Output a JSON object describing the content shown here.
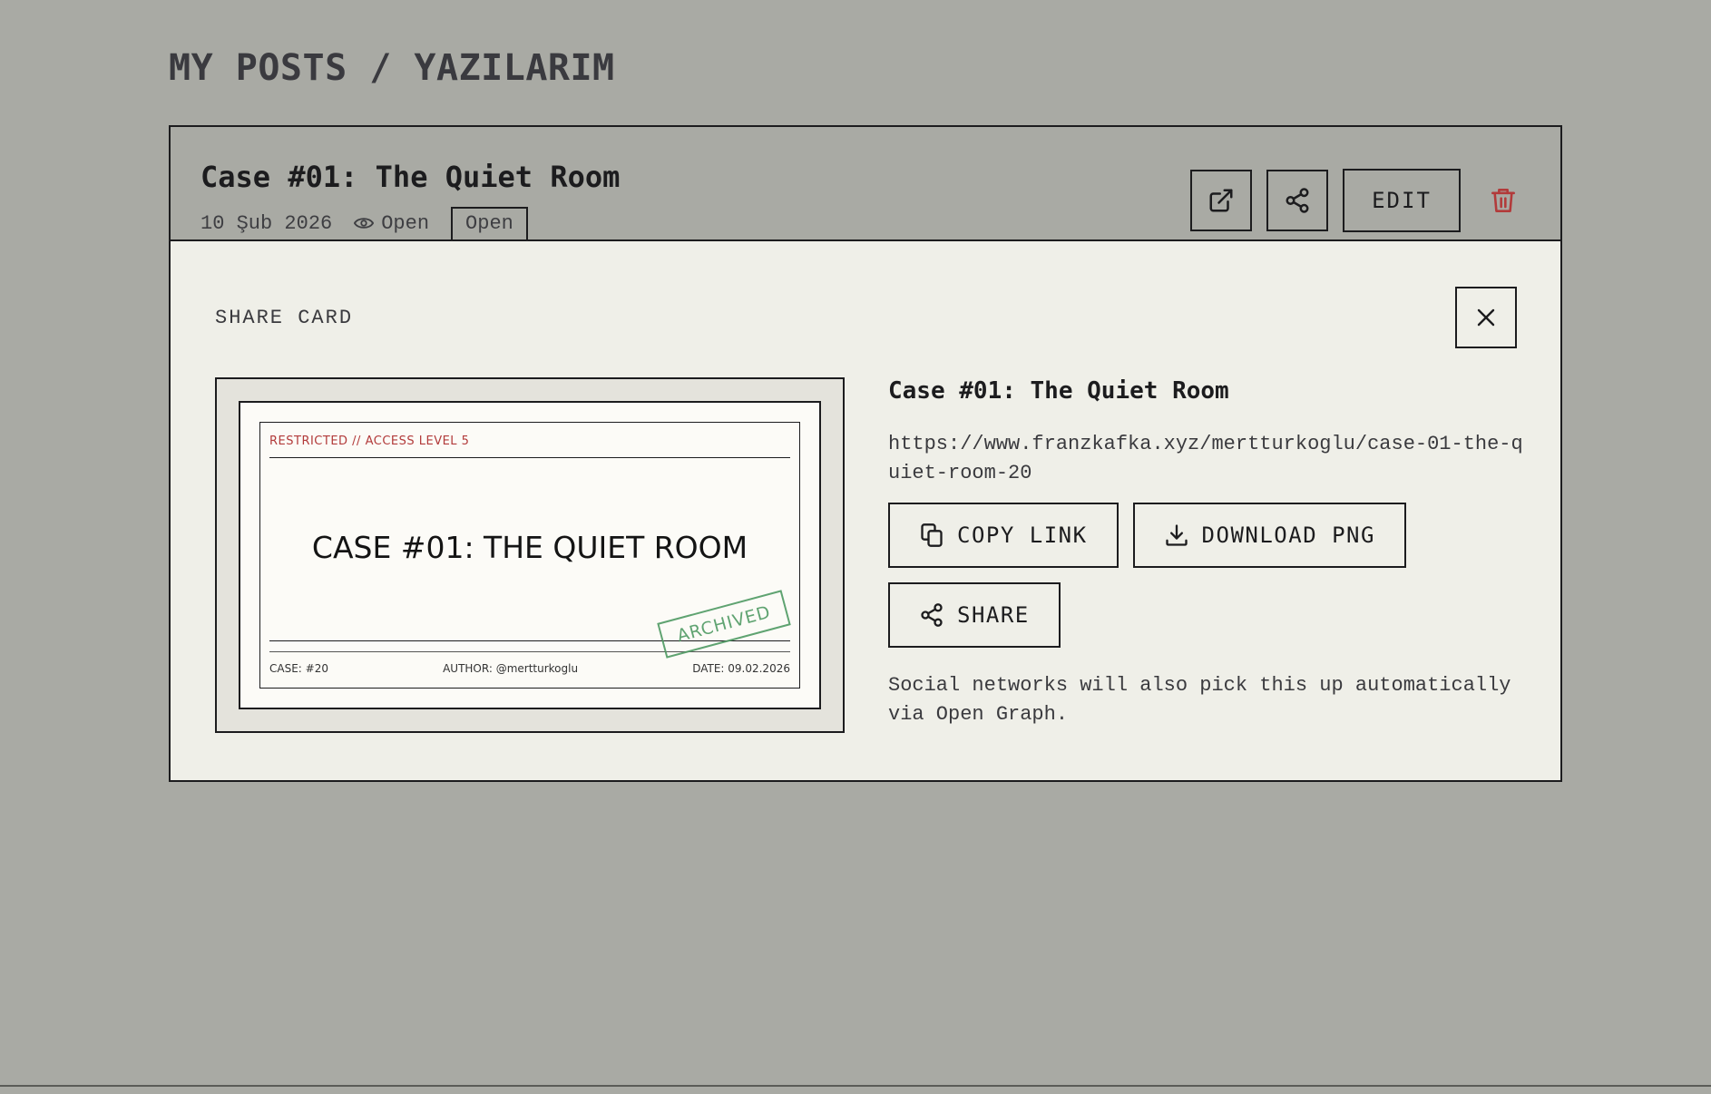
{
  "page": {
    "title": "MY POSTS / YAZILARIM"
  },
  "post": {
    "title": "Case #01: The Quiet Room",
    "date": "10 Şub 2026",
    "visibility": "Open",
    "status_badge": "Open",
    "actions": {
      "open_icon": "external-link-icon",
      "share_icon": "share-icon",
      "edit_label": "EDIT",
      "delete_icon": "trash-icon"
    }
  },
  "share_card": {
    "heading": "SHARE CARD",
    "close_icon": "close-icon",
    "preview": {
      "restricted_label": "RESTRICTED // ACCESS LEVEL 5",
      "title": "CASE #01: THE QUIET ROOM",
      "case_label": "CASE: #20",
      "author_label": "AUTHOR: @mertturkoglu",
      "date_label": "DATE: 09.02.2026",
      "stamp": "ARCHIVED"
    },
    "info": {
      "title": "Case #01: The Quiet Room",
      "url": "https://www.franzkafka.xyz/mertturkoglu/case-01-the-quiet-room-20",
      "copy_label": "COPY LINK",
      "download_label": "DOWNLOAD PNG",
      "share_label": "SHARE",
      "note": "Social networks will also pick this up automatically via Open Graph."
    }
  },
  "colors": {
    "background": "#a9aaa4",
    "panel": "#efefe8",
    "danger": "#b23a3a",
    "stamp": "#4f9a63",
    "ink": "#1c1c1e"
  }
}
